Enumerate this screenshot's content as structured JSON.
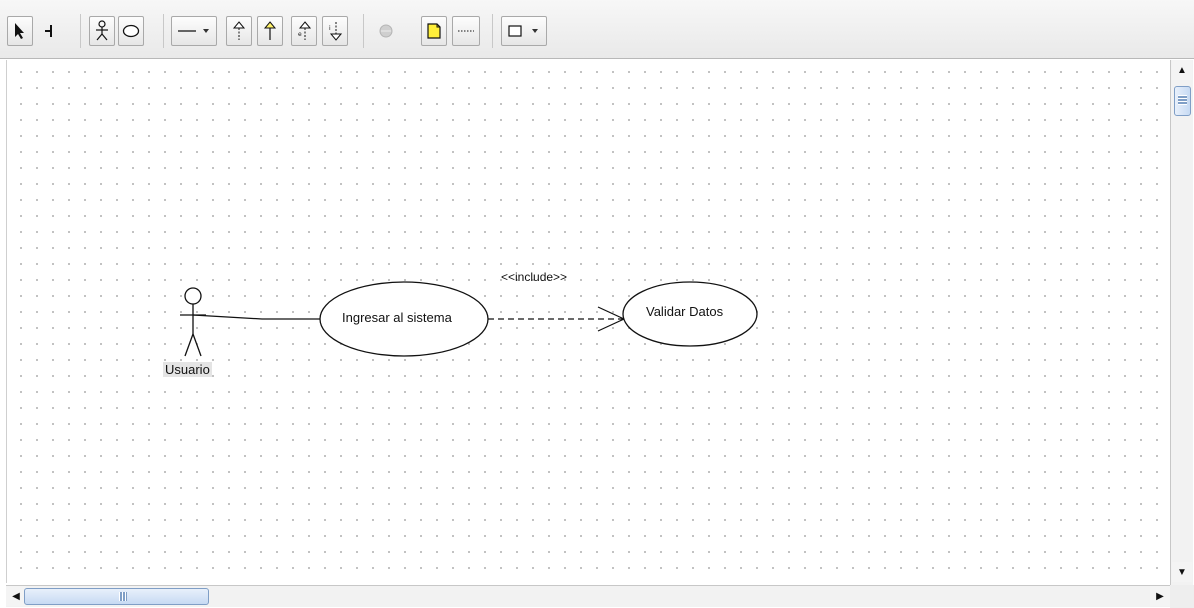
{
  "toolbar": {
    "tools": [
      {
        "name": "select-tool",
        "icon": "arrow-pointer-icon"
      },
      {
        "name": "boundary-tool",
        "icon": "boundary-icon"
      },
      {
        "name": "actor-tool",
        "icon": "actor-icon"
      },
      {
        "name": "usecase-tool",
        "icon": "ellipse-icon"
      },
      {
        "name": "association-tool",
        "icon": "line-dropdown-icon"
      },
      {
        "name": "generalization-tool",
        "icon": "hollow-arrow-up-icon"
      },
      {
        "name": "dependency-tool",
        "icon": "filled-arrow-up-icon"
      },
      {
        "name": "include-tool",
        "icon": "include-arrow-icon"
      },
      {
        "name": "extend-tool",
        "icon": "extend-arrow-icon"
      },
      {
        "name": "disabled-tool",
        "icon": "grey-circle-icon"
      },
      {
        "name": "note-tool",
        "icon": "note-icon"
      },
      {
        "name": "note-link-tool",
        "icon": "dashed-line-icon"
      },
      {
        "name": "shape-tool",
        "icon": "rectangle-dropdown-icon"
      }
    ]
  },
  "diagram": {
    "actor": {
      "label": "Usuario"
    },
    "usecases": [
      {
        "label": "Ingresar al sistema"
      },
      {
        "label": "Validar Datos"
      }
    ],
    "relation": {
      "stereotype": "<<include>>"
    }
  },
  "colors": {
    "note_yellow": "#ffef3a",
    "scroll_thumb": "#c7daf3",
    "dot_grid": "#b9b9b9"
  }
}
